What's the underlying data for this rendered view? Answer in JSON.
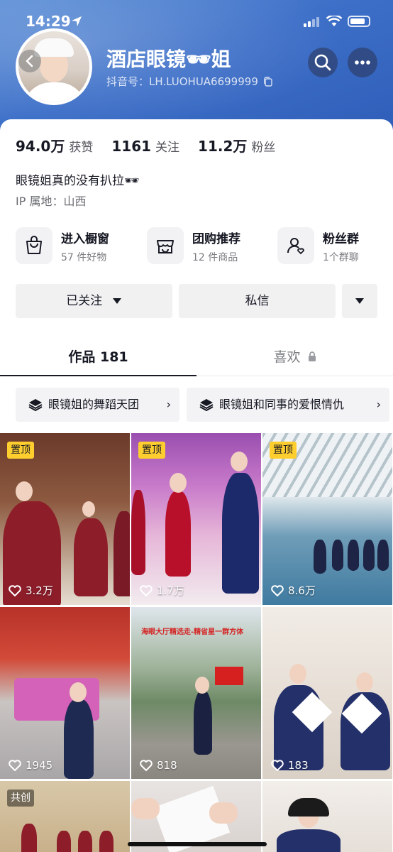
{
  "status_bar": {
    "time": "14:29"
  },
  "profile": {
    "name": "酒店眼镜🕶姐",
    "douyin_id": "抖音号：LH.LUOHUA6699999",
    "stats": [
      {
        "value": "94.0万",
        "label": "获赞"
      },
      {
        "value": "1161",
        "label": "关注"
      },
      {
        "value": "11.2万",
        "label": "粉丝"
      }
    ],
    "bio": "眼镜姐真的没有扒拉🕶",
    "ip": "IP 属地：山西"
  },
  "services": [
    {
      "title": "进入橱窗",
      "sub": "57 件好物",
      "icon": "shopping-bag-icon"
    },
    {
      "title": "团购推荐",
      "sub": "12 件商品",
      "icon": "store-icon"
    },
    {
      "title": "粉丝群",
      "sub": "1个群聊",
      "icon": "group-icon"
    }
  ],
  "actions": {
    "follow": "已关注",
    "message": "私信"
  },
  "tabs": {
    "works": "作品 181",
    "likes": "喜欢"
  },
  "collections": [
    {
      "label": "眼镜姐的舞蹈天团"
    },
    {
      "label": "眼镜姐和同事的爱恨情仇"
    }
  ],
  "videos": [
    {
      "badge": "置顶",
      "likes": "3.2万"
    },
    {
      "badge": "置顶",
      "likes": "1.7万"
    },
    {
      "badge": "置顶",
      "likes": "8.6万"
    },
    {
      "badge": "",
      "likes": "1945"
    },
    {
      "badge": "",
      "likes": "818",
      "caption": "海眼大厅精选走-精省星一群方体"
    },
    {
      "badge": "",
      "likes": "183"
    },
    {
      "badge": "共创",
      "likes": ""
    },
    {
      "badge": "",
      "likes": ""
    },
    {
      "badge": "",
      "likes": ""
    }
  ],
  "colors": {
    "header": "#3d6fc8",
    "pin_badge": "#fece2f",
    "button_bg": "#f1f1f2"
  }
}
